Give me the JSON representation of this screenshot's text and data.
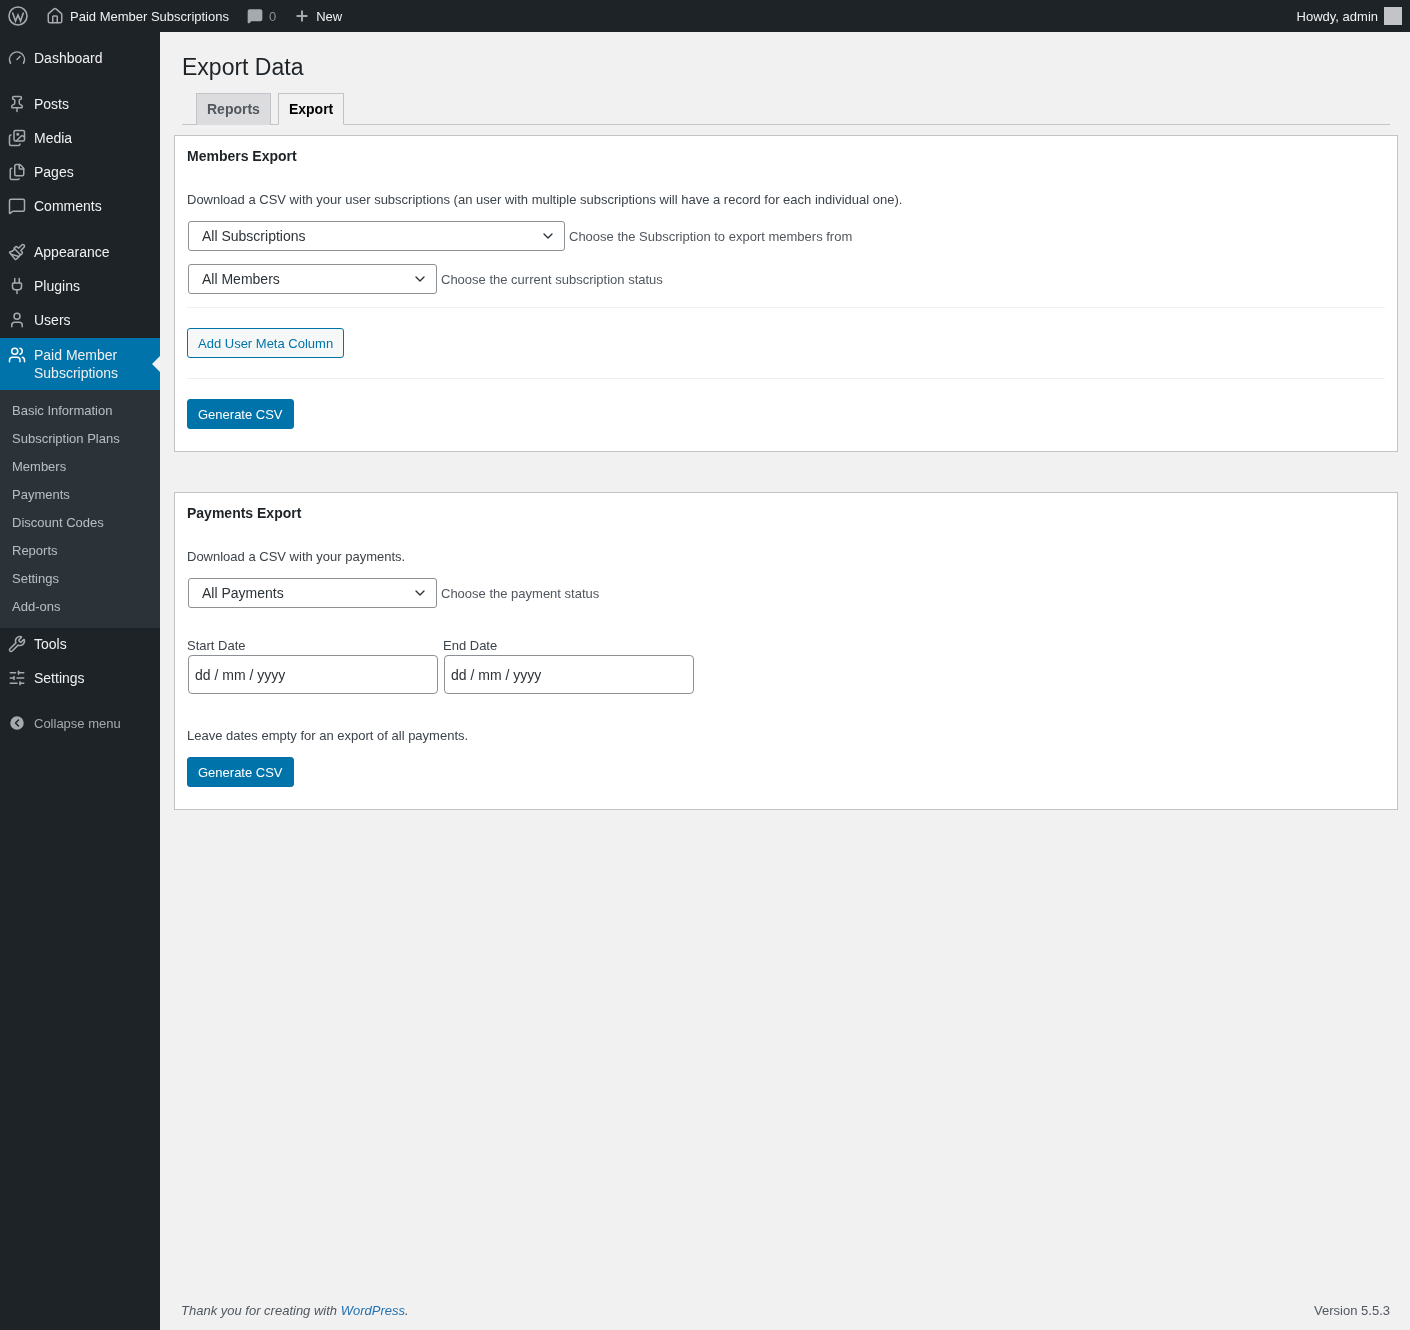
{
  "admin_bar": {
    "site_name": "Paid Member Subscriptions",
    "comments_count": "0",
    "new_label": "New",
    "greeting": "Howdy, admin"
  },
  "sidebar": {
    "groups": [
      [
        {
          "label": "Dashboard",
          "selected": false
        }
      ],
      [
        {
          "label": "Posts",
          "selected": false
        },
        {
          "label": "Media",
          "selected": false
        },
        {
          "label": "Pages",
          "selected": false
        },
        {
          "label": "Comments",
          "selected": false
        }
      ],
      [
        {
          "label": "Appearance",
          "selected": false
        },
        {
          "label": "Plugins",
          "selected": false
        },
        {
          "label": "Users",
          "selected": false
        },
        {
          "label": "Paid Member Subscriptions",
          "selected": true,
          "children": [
            {
              "label": "Basic Information",
              "selected": false
            },
            {
              "label": "Subscription Plans",
              "selected": false
            },
            {
              "label": "Members",
              "selected": false
            },
            {
              "label": "Payments",
              "selected": false
            },
            {
              "label": "Discount Codes",
              "selected": false
            },
            {
              "label": "Reports",
              "selected": false
            },
            {
              "label": "Settings",
              "selected": false
            },
            {
              "label": "Add-ons",
              "selected": false
            }
          ]
        },
        {
          "label": "Tools",
          "selected": false
        },
        {
          "label": "Settings",
          "selected": false
        }
      ]
    ],
    "collapse_label": "Collapse menu"
  },
  "page_title": "Export Data",
  "tabs": [
    {
      "label": "Reports",
      "selected": false
    },
    {
      "label": "Export",
      "selected": true
    }
  ],
  "members_export": {
    "title": "Members Export",
    "description": "Download a CSV with your user subscriptions (an user with multiple subscriptions will have a record for each individual one).",
    "selects": [
      {
        "value": "All Subscriptions",
        "hint": "Choose the Subscription to export members from",
        "wide": true
      },
      {
        "value": "All Members",
        "hint": "Choose the current subscription status",
        "wide": false
      }
    ],
    "meta_button": "Add User Meta Column",
    "generate_button": "Generate CSV"
  },
  "payments_export": {
    "title": "Payments Export",
    "description": "Download a CSV with your payments.",
    "select": {
      "value": "All Payments",
      "hint": "Choose the payment status"
    },
    "start_date": {
      "label": "Start Date",
      "placeholder": "dd / mm / yyyy"
    },
    "end_date": {
      "label": "End Date",
      "placeholder": "dd / mm / yyyy"
    },
    "note": "Leave dates empty for an export of all payments.",
    "generate_button": "Generate CSV"
  },
  "footer": {
    "text_before": "Thank you for creating with ",
    "link": "WordPress",
    "text_after": ".",
    "version": "Version 5.5.3"
  }
}
